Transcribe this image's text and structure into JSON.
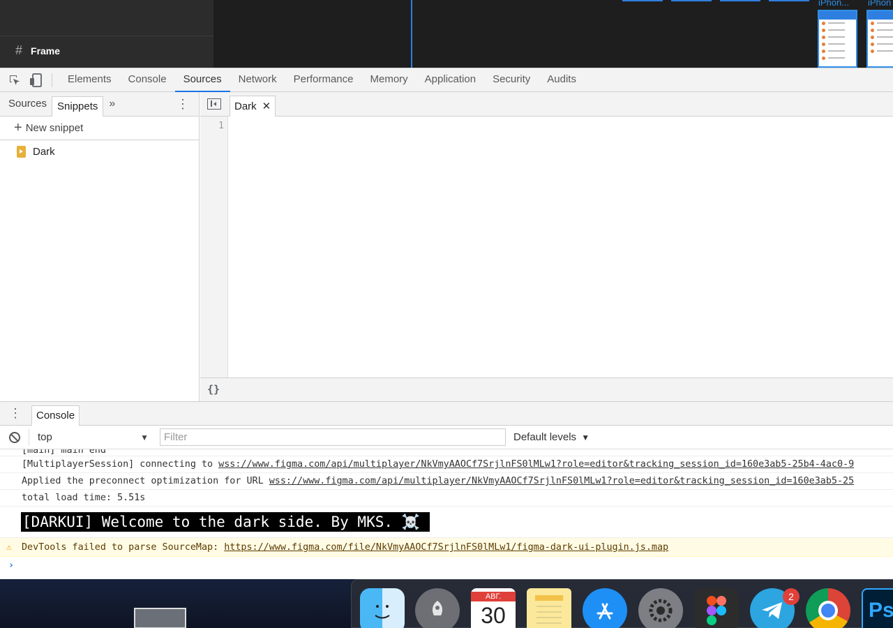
{
  "figma": {
    "frame_label": "Frame",
    "phone_labels": [
      "iPhon...",
      "iPhon"
    ]
  },
  "devtools": {
    "tabs": [
      "Elements",
      "Console",
      "Sources",
      "Network",
      "Performance",
      "Memory",
      "Application",
      "Security",
      "Audits"
    ],
    "active_tab": "Sources",
    "navigator": {
      "tabs": [
        "Sources",
        "Snippets"
      ],
      "active_tab": "Snippets",
      "new_snippet_label": "New snippet",
      "files": [
        "Dark"
      ]
    },
    "editor": {
      "open_file": "Dark",
      "line_numbers": [
        "1"
      ],
      "pretty_print_label": "{}"
    },
    "drawer": {
      "tab_label": "Console",
      "context_value": "top",
      "filter_placeholder": "Filter",
      "levels_label": "Default levels"
    },
    "console": {
      "cut_line": "[main] main end",
      "messages": [
        {
          "text": "[MultiplayerSession] connecting to ",
          "link": "wss://www.figma.com/api/multiplayer/NkVmyAAOCf7SrjlnFS0lMLw1?role=editor&tracking_session_id=160e3ab5-25b4-4ac0-9"
        },
        {
          "text": "Applied the preconnect optimization for URL ",
          "link": "wss://www.figma.com/api/multiplayer/NkVmyAAOCf7SrjlnFS0lMLw1?role=editor&tracking_session_id=160e3ab5-25"
        },
        {
          "text": "total load time: 5.51s",
          "link": ""
        }
      ],
      "styled_message": "[DARKUI] Welcome to the dark side. By MKS. ☠️",
      "warning_text": "DevTools failed to parse SourceMap: ",
      "warning_link": "https://www.figma.com/file/NkVmyAAOCf7SrjlnFS0lMLw1/figma-dark-ui-plugin.js.map",
      "prompt_symbol": "›"
    }
  },
  "dock": {
    "calendar_month": "АВГ.",
    "calendar_day": "30",
    "telegram_badge": "2",
    "photoshop_label": "Ps"
  },
  "colors": {
    "accent": "#1a73e8",
    "figma_dark": "#2c2c2c",
    "warning_bg": "#fffbe5"
  }
}
